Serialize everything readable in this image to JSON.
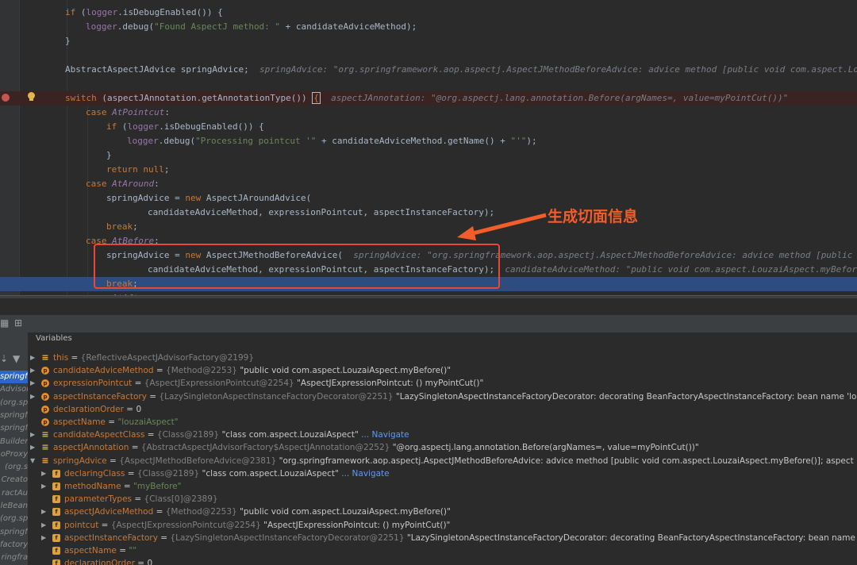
{
  "editor": {
    "lines": [
      {
        "segs": [
          {
            "c": "kw",
            "t": "if "
          },
          {
            "t": "("
          },
          {
            "c": "var",
            "t": "logger"
          },
          {
            "t": ".isDebugEnabled()) {"
          }
        ]
      },
      {
        "segs": [
          {
            "c": "var",
            "t": "logger"
          },
          {
            "t": ".debug("
          },
          {
            "c": "str",
            "t": "\"Found AspectJ method: \""
          },
          {
            "t": " + candidateAdviceMethod);"
          }
        ]
      },
      {
        "segs": [
          {
            "t": "}"
          }
        ]
      },
      {
        "segs": []
      },
      {
        "segs": [
          {
            "t": "AbstractAspectJAdvice springAdvice;  "
          },
          {
            "c": "inline",
            "t": "springAdvice: \"org.springframework.aop.aspectj.AspectJMethodBeforeAdvice: advice method [public void com.aspect.LouzaiAspect.myBefore()]; aspect name 'louzaiAspect'\""
          }
        ]
      },
      {
        "segs": []
      },
      {
        "segs": [
          {
            "c": "kw",
            "t": "switch "
          },
          {
            "t": "(aspectJAnnotation.getAnnotationType()) "
          },
          {
            "c": "ibox",
            "t": "{"
          },
          {
            "t": "  "
          },
          {
            "c": "inline",
            "t": "aspectJAnnotation: \"@org.aspectj.lang.annotation.Before(argNames=, value=myPointCut())\""
          }
        ]
      },
      {
        "segs": [
          {
            "c": "kw",
            "t": "case "
          },
          {
            "c": "it",
            "t": "AtPointcut"
          },
          {
            "t": ":"
          }
        ]
      },
      {
        "segs": [
          {
            "c": "kw",
            "t": "if "
          },
          {
            "t": "("
          },
          {
            "c": "var",
            "t": "logger"
          },
          {
            "t": ".isDebugEnabled()) {"
          }
        ]
      },
      {
        "segs": [
          {
            "c": "var",
            "t": "logger"
          },
          {
            "t": ".debug("
          },
          {
            "c": "str",
            "t": "\"Processing pointcut '\""
          },
          {
            "t": " + candidateAdviceMethod.getName() + "
          },
          {
            "c": "str",
            "t": "\"'\""
          },
          {
            "t": ");"
          }
        ]
      },
      {
        "segs": [
          {
            "t": "}"
          }
        ]
      },
      {
        "segs": [
          {
            "c": "kw",
            "t": "return null"
          },
          {
            "t": ";"
          }
        ]
      },
      {
        "segs": [
          {
            "c": "kw",
            "t": "case "
          },
          {
            "c": "it",
            "t": "AtAround"
          },
          {
            "t": ":"
          }
        ]
      },
      {
        "segs": [
          {
            "t": "springAdvice = "
          },
          {
            "c": "kw",
            "t": "new "
          },
          {
            "t": "AspectJAroundAdvice("
          }
        ]
      },
      {
        "segs": [
          {
            "t": "candidateAdviceMethod, expressionPointcut, aspectInstanceFactory);"
          }
        ]
      },
      {
        "segs": [
          {
            "c": "kw",
            "t": "break"
          },
          {
            "t": ";"
          }
        ]
      },
      {
        "segs": [
          {
            "c": "kw",
            "t": "case "
          },
          {
            "c": "it",
            "t": "AtBefore"
          },
          {
            "t": ":"
          }
        ]
      },
      {
        "segs": [
          {
            "t": "springAdvice = "
          },
          {
            "c": "kw",
            "t": "new "
          },
          {
            "t": "AspectJMethodBeforeAdvice(  "
          },
          {
            "c": "inline",
            "t": "springAdvice: \"org.springframework.aop.aspectj.AspectJMethodBeforeAdvice: advice method [public void com.aspect.LouzaiAspect.myBefore()]\""
          }
        ]
      },
      {
        "segs": [
          {
            "t": "candidateAdviceMethod, expressionPointcut, aspectInstanceFactory);  "
          },
          {
            "c": "inline",
            "t": "candidateAdviceMethod: \"public void com.aspect.LouzaiAspect.myBefore()\""
          }
        ]
      },
      {
        "segs": [
          {
            "c": "kw",
            "t": "break"
          },
          {
            "t": ";"
          }
        ]
      },
      {
        "segs": [
          {
            "c": "kw",
            "t": "case "
          },
          {
            "c": "it",
            "t": "AtAfter"
          },
          {
            "t": ":"
          }
        ]
      }
    ],
    "annotation": "生成切面信息"
  },
  "frames_panel": {
    "items": [
      "springfra",
      "Advisor",
      "(org.sp",
      "springfr",
      "springf",
      "Builder",
      "oProxy",
      "(org.s",
      "Creato",
      "ractAu",
      "leBean",
      "(org.sp",
      "springfr",
      "factory.s",
      "ringfra"
    ]
  },
  "variables_panel": {
    "title": "Variables",
    "rows": [
      {
        "icon": "lines",
        "name": "this",
        "type": "{ReflectiveAspectJAdvisorFactory@2199}",
        "value": "",
        "expand": true
      },
      {
        "icon": "p",
        "name": "candidateAdviceMethod",
        "type": "{Method@2253}",
        "value": "\"public void com.aspect.LouzaiAspect.myBefore()\"",
        "expand": true
      },
      {
        "icon": "p",
        "name": "expressionPointcut",
        "type": "{AspectJExpressionPointcut@2254}",
        "value": "\"AspectJExpressionPointcut: () myPointCut()\"",
        "expand": true
      },
      {
        "icon": "p",
        "name": "aspectInstanceFactory",
        "type": "{LazySingletonAspectInstanceFactoryDecorator@2251}",
        "value": "\"LazySingletonAspectInstanceFactoryDecorator: decorating BeanFactoryAspectInstanceFactory: bean name 'louzaiAspect'\"",
        "expand": true
      },
      {
        "icon": "p",
        "name": "declarationOrder",
        "type": "",
        "value": "0",
        "expand": false
      },
      {
        "icon": "p",
        "name": "aspectName",
        "type": "",
        "value": "\"louzaiAspect\"",
        "str": true,
        "expand": false
      },
      {
        "icon": "lines",
        "name": "candidateAspectClass",
        "type": "{Class@2189}",
        "value": "\"class com.aspect.LouzaiAspect\"",
        "nav": "... Navigate",
        "expand": true
      },
      {
        "icon": "lines",
        "name": "aspectJAnnotation",
        "type": "{AbstractAspectJAdvisorFactory$AspectJAnnotation@2252}",
        "value": "\"@org.aspectj.lang.annotation.Before(argNames=, value=myPointCut())\"",
        "expand": true
      },
      {
        "icon": "lines",
        "name": "springAdvice",
        "type": "{AspectJMethodBeforeAdvice@2381}",
        "value": "\"org.springframework.aop.aspectj.AspectJMethodBeforeAdvice: advice method [public void com.aspect.LouzaiAspect.myBefore()]; aspect name \"\"",
        "expand": "open"
      },
      {
        "icon": "f",
        "name": "declaringClass",
        "type": "{Class@2189}",
        "value": "\"class com.aspect.LouzaiAspect\"",
        "nav": "... Navigate",
        "expand": true,
        "indent": 1
      },
      {
        "icon": "f",
        "name": "methodName",
        "type": "",
        "value": "\"myBefore\"",
        "str": true,
        "expand": true,
        "indent": 1
      },
      {
        "icon": "f",
        "name": "parameterTypes",
        "type": "{Class[0]@2389}",
        "value": "",
        "expand": false,
        "indent": 1
      },
      {
        "icon": "f",
        "name": "aspectJAdviceMethod",
        "type": "{Method@2253}",
        "value": "\"public void com.aspect.LouzaiAspect.myBefore()\"",
        "expand": true,
        "indent": 1
      },
      {
        "icon": "f",
        "name": "pointcut",
        "type": "{AspectJExpressionPointcut@2254}",
        "value": "\"AspectJExpressionPointcut: () myPointCut()\"",
        "expand": true,
        "indent": 1
      },
      {
        "icon": "f",
        "name": "aspectInstanceFactory",
        "type": "{LazySingletonAspectInstanceFactoryDecorator@2251}",
        "value": "\"LazySingletonAspectInstanceFactoryDecorator: decorating BeanFactoryAspectInstanceFactory: bean name 'louzaiAspect'\"",
        "expand": true,
        "indent": 1
      },
      {
        "icon": "f",
        "name": "aspectName",
        "type": "",
        "value": "\"\"",
        "str": true,
        "expand": false,
        "indent": 1
      },
      {
        "icon": "f",
        "name": "declarationOrder",
        "type": "",
        "value": "0",
        "expand": false,
        "indent": 1
      }
    ]
  },
  "colors": {
    "keyword": "#cc7832",
    "string": "#6a8759",
    "field": "#9876aa",
    "exec_line": "#2d4d80",
    "breakpoint": "#c75450",
    "annotation": "#f25d2a"
  }
}
